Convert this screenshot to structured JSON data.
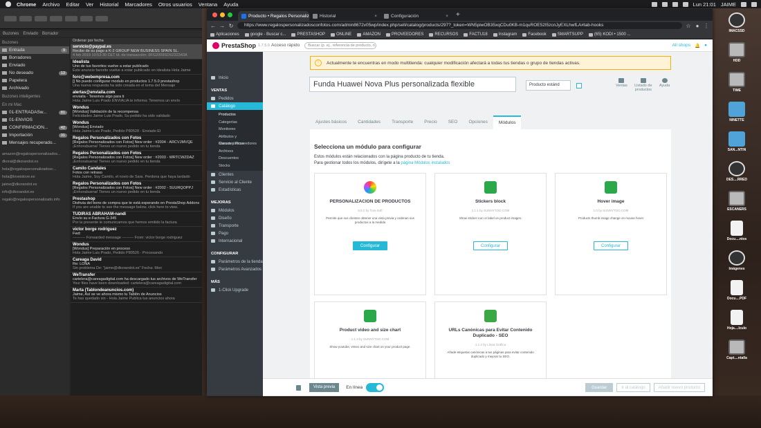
{
  "menubar": {
    "app": "Chrome",
    "items": [
      "Archivo",
      "Editar",
      "Ver",
      "Historial",
      "Marcadores",
      "Otros usuarios",
      "Ventana",
      "Ayuda"
    ],
    "clock": "Lun 21:01",
    "user": "JAIME"
  },
  "mail": {
    "tab_labels": [
      "Buzones",
      "Enviado",
      "Borrador"
    ],
    "sidebar_header": "Buzones",
    "mailboxes": [
      {
        "label": "Entrada",
        "count": "9"
      },
      {
        "label": "Borradores",
        "count": ""
      },
      {
        "label": "Enviado",
        "count": ""
      },
      {
        "label": "No deseado",
        "count": "13"
      },
      {
        "label": "Papelera",
        "count": ""
      },
      {
        "label": "Archivado",
        "count": ""
      }
    ],
    "smart_header": "Buzones inteligentes",
    "mac_header": "En mi Mac",
    "local": [
      {
        "label": "01-ENTRADASw...",
        "count": "81"
      },
      {
        "label": "01-ENVIOS",
        "count": ""
      },
      {
        "label": "CONFIRMACION...",
        "count": "42"
      },
      {
        "label": "Importación",
        "count": "31"
      },
      {
        "label": "Mensajes recuperado...",
        "count": ""
      }
    ],
    "accounts": [
      "amazon@regalospersonalizados...",
      "dkoral@dkorandot.es",
      "hola@regalospersonalizadosc...",
      "hola@loveislove.es",
      "jaime@dkorandot.es",
      "info@dkorandot.es",
      "regalo@regalospersonalizado.info"
    ],
    "sort_label": "Ordenar por fecha",
    "messages": [
      {
        "from": "servicio@paypal.es",
        "subject": "Recibo de su pago a K-2 GROUP NEW BUSINESS SPAIN SL.",
        "preview": "4 feb 2019 10:53:30 CET Id. de transacción: 0FG2009SDS232343A"
      },
      {
        "from": "Idealista",
        "subject": "Uno de tus favoritos vuelve a estar publicado",
        "preview": "Este anuncio favorito vuelve a estar publicado en idealista Hola Jaime"
      },
      {
        "from": "foro@webempresa.com",
        "subject": "[] No puedo configurar modulo en productos 1.7.5.0 prestashop",
        "preview": "Una nueva respuesta ha sido creada en el tema del Mensaje"
      },
      {
        "from": "alertas@enviaila.com",
        "subject": "enviaila - Tenemos algo para ti",
        "preview": "Hola Jaime Luis Prado ENVIALIA te informa: Tenemos un envío"
      },
      {
        "from": "Wondus",
        "subject": "[Wondus] Validación de la recompensa",
        "preview": "Felicidades Jaime Luis Prado, Su pedido ha sido validado"
      },
      {
        "from": "Wondus",
        "subject": "[Wondus] Enviado",
        "preview": "Hola Jaime Luis Prado, Pedido P80528 - Enviado El"
      },
      {
        "from": "Regalos Personalizados con Fotos",
        "subject": "[Regalos Personalizados con Fotos] New order : #2004 - ARCVJMVQE",
        "preview": "¡Enhorabuena! Tienes un nuevo pedido en tu tienda"
      },
      {
        "from": "Regalos Personalizados con Fotos",
        "subject": "[Regalos Personalizados con Fotos] New order : #2003 - WRTCWZDAZ",
        "preview": "¡Enhorabuena! Tienes un nuevo pedido en tu tienda"
      },
      {
        "from": "Camilo Candales",
        "subject": "Fotos con retraso",
        "preview": "Hola Jaime, Soy Camilo, el novio de Sara. Perdona que haya tardado"
      },
      {
        "from": "Regalos Personalizados con Fotos",
        "subject": "[Regalos Personalizados con Fotos] New order : #2002 - SUURQOPPJ",
        "preview": "¡Enhorabuena! Tienes un nuevo pedido en tu tienda"
      },
      {
        "from": "Prestashop",
        "subject": "Disfruta del bono de compra que te está esperando en PrestaShop Addons",
        "preview": "If you are unable to see the message below, click here to view."
      },
      {
        "from": "TUDIRAS ABRAHAM-nandi",
        "subject": "Envío su e-Factura G-345",
        "preview": "Por la presente le comunicamos que hemos emitido la factura"
      },
      {
        "from": "victor borge rodriguez",
        "subject": "Fwd:",
        "preview": "---------- Forwarded message --------- From: victor borge rodriguez"
      },
      {
        "from": "Wondus",
        "subject": "[Wondus] Preparación en proceso",
        "preview": "Hola Jaime Luis Prado, Pedido P80526 - Procesando"
      },
      {
        "from": "Careaga David",
        "subject": "Re: LONA",
        "preview": "Sin problema De: \"jaime@dkorandot.es\" Fecha: Mon"
      },
      {
        "from": "WeTransfer",
        "subject": "cartelera@careagadigital.com ha descargado tus archivos de WeTransfer",
        "preview": "Your files have been downloaded: cartelera@careagadigital.com"
      },
      {
        "from": "Marta (Tablondeanuncios.com)",
        "subject": "Jaime, Así se ve ahora mismo tu Tablón de Anuncios",
        "preview": "Te has quedado sin - Hola Jaime Publica tus anuncios ahora"
      }
    ]
  },
  "chrome": {
    "tabs": [
      {
        "label": "Producto • Regalos Personaliz"
      },
      {
        "label": "Historial"
      },
      {
        "label": "Configuración"
      }
    ],
    "url": "https://www.regalospersonalizadosconfotos.com/admin8672v05wp/index.php/sell/catalog/products/297?_token=WN5piwOB35xqCDu0KB-m1quROE52I5zcnJyEXLhwfLA#tab-hooks",
    "bookmarks": [
      "Aplicaciones",
      "google - Buscar c...",
      "PRESTASHOP",
      "ONLINE",
      "AMAZON",
      "PROVEEDORES",
      "RECURSOS",
      "FACTU18",
      "Instagram",
      "Facebook",
      "SMARTSUPP",
      "(65) KODI • 1500 ..."
    ]
  },
  "ps": {
    "brand": "PrestaShop",
    "version": "1.7.5.0",
    "quick_access": "Acceso rápido",
    "search_placeholder": "Buscar (p. ej., referencia de producto, n",
    "shop_selector": "All shops",
    "nav": {
      "home": "Inicio",
      "sec_ventas": "VENTAS",
      "pedidos": "Pedidos",
      "catalogo": "Catálogo",
      "catalog_sub": [
        "Productos",
        "Categorías",
        "Monitoreo",
        "Atributos y Características",
        "Marcas y Proveedores",
        "Archivos",
        "Descuentos",
        "Stocks"
      ],
      "clientes": "Clientes",
      "servicio": "Servicio al Cliente",
      "estadisticas": "Estadísticas",
      "sec_mejoras": "MEJORAS",
      "modulos": "Módulos",
      "diseno": "Diseño",
      "transporte": "Transporte",
      "pago": "Pago",
      "internacional": "Internacional",
      "sec_configurar": "CONFIGURAR",
      "parametros_tienda": "Parámetros de la tienda",
      "parametros_avanzados": "Parámetros Avanzados",
      "sec_mas": "MÁS",
      "upgrade": "1-Click Upgrade"
    },
    "alert": "Actualmente te encuentras en modo multitienda: cualquier modificación afectará a todas tus tiendas o grupo de tiendas activas.",
    "product_name": "Funda Huawei Nova Plus personalizada flexible",
    "product_type": "Producto estánd",
    "tools": [
      "Ventas",
      "Listado de productos",
      "Ayuda"
    ],
    "tabs": [
      "Ajustes básicos",
      "Cantidades",
      "Transporte",
      "Precio",
      "SEO",
      "Opciones",
      "Módulos"
    ],
    "modules_title": "Selecciona un módulo para configurar",
    "modules_desc1": "Estos módulos están relacionados con la página producto de tu tienda.",
    "modules_desc2": "Para gestionar todos los módulos, dirígete a la",
    "modules_link": "página Módulos instalados",
    "cards": [
      {
        "name": "PERSONALIZACION DE PRODUCTOS",
        "version": "5.8.2 by Tuni-Soft",
        "desc": "Permite que sus clientes obtener una vista previa y ordenan sus productos a la medida",
        "button": "Configurar"
      },
      {
        "name": "Stickers block",
        "version": "1.1.1 by SUNNYTOO.COM",
        "desc": "Show sticker icon or label on product images.",
        "button": "Configurar"
      },
      {
        "name": "Hover image",
        "version": "1.0 by SUNNYTOO.COM",
        "desc": "Products thumb image change on mouse hover",
        "button": "Configurar"
      },
      {
        "name": "Product video and size chart",
        "version": "1.1.3 by SUNNYTOO.COM",
        "desc": "Show youtube, vimeo and size chart on your product page.",
        "button": ""
      },
      {
        "name": "URLs Canónicas para Evitar Contenido Duplicado - SEO",
        "version": "1.1.2 by Línea Gráfica",
        "desc": "Añade etiquetas canónicas a tus páginas para evitar contenido duplicado y mejorar tu SEO.",
        "button": ""
      }
    ],
    "footer": {
      "preview": "Vista previa",
      "online": "En línea",
      "save": "Guardar",
      "catalog": "Ir al catálogo",
      "add_new": "Añadir nuevo producto"
    }
  },
  "desktop": [
    "IMACSSD",
    "HDD",
    "TIME",
    "NINETTE",
    "SAN...NTIN",
    "DES....RRED",
    "ESCANERS",
    "Docu....ntos",
    "Imágenes",
    "Docu....PDF",
    "Hoja....lculo",
    "Capt....ntalla"
  ],
  "colors": {
    "ps_accent": "#25b9d7",
    "ps_sidebar": "#363a41",
    "alert_border": "#fab000"
  }
}
